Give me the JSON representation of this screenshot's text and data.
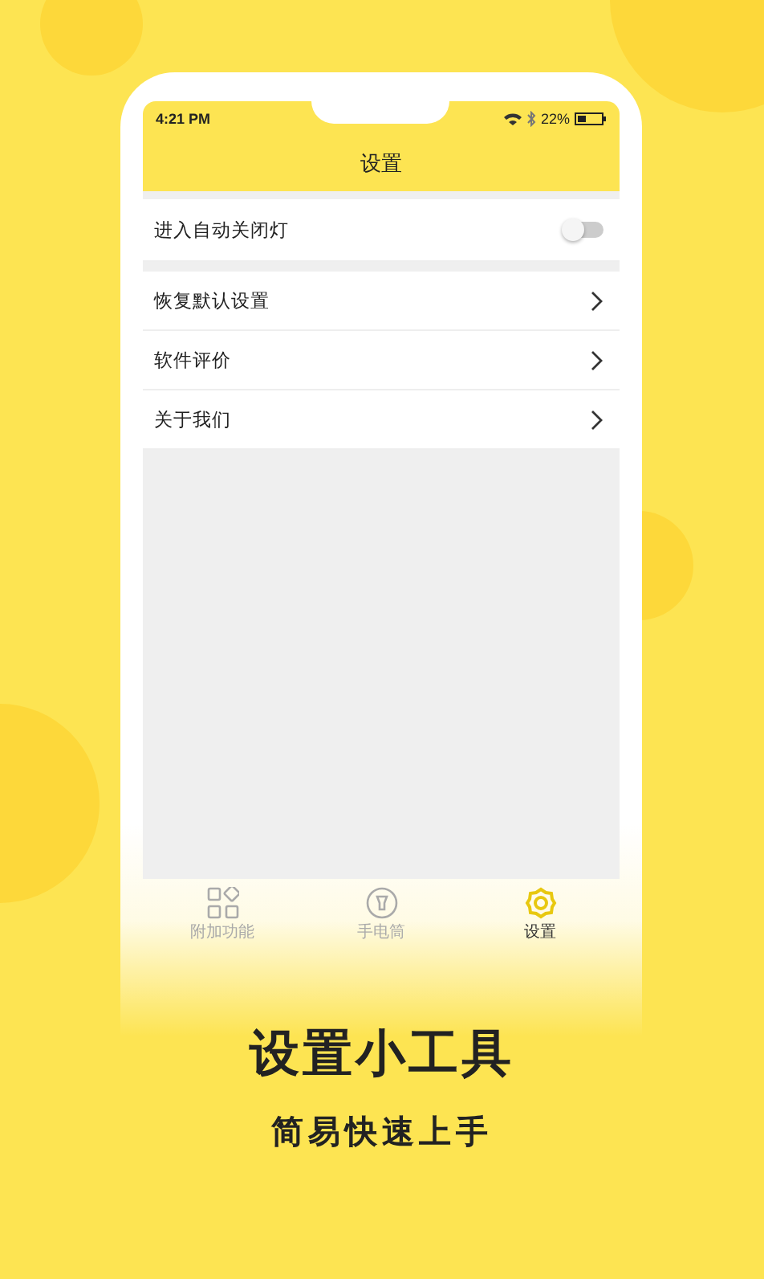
{
  "status_bar": {
    "time": "4:21 PM",
    "battery": "22%"
  },
  "header": {
    "title": "设置"
  },
  "sections": [
    {
      "items": [
        {
          "kind": "toggle",
          "label": "进入自动关闭灯",
          "on": false
        }
      ]
    },
    {
      "items": [
        {
          "kind": "link",
          "label": "恢复默认设置"
        },
        {
          "kind": "link",
          "label": "软件评价"
        },
        {
          "kind": "link",
          "label": "关于我们"
        }
      ]
    }
  ],
  "tab_bar": [
    {
      "kind": "grid",
      "label": "附加功能",
      "selected": false
    },
    {
      "kind": "flashlight",
      "label": "手电筒",
      "selected": false
    },
    {
      "kind": "gear",
      "label": "设置",
      "selected": true
    }
  ],
  "promo": {
    "title": "设置小工具",
    "subtitle": "简易快速上手"
  }
}
